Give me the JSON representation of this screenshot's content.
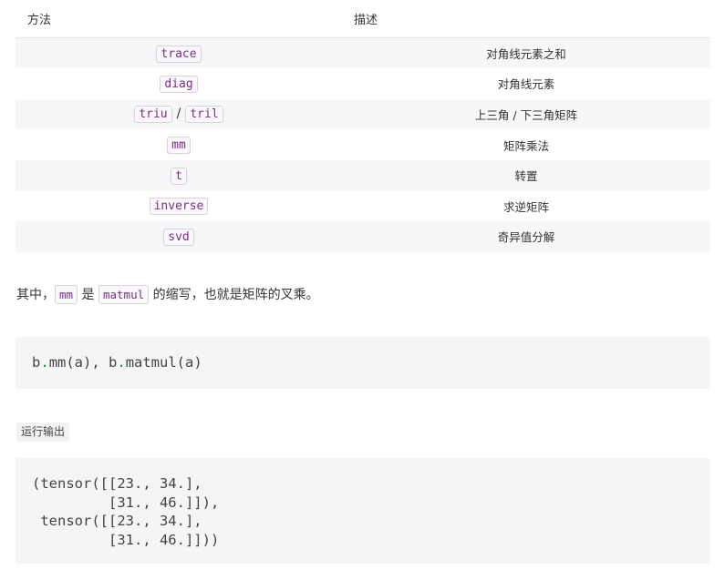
{
  "table": {
    "headers": [
      "方法",
      "描述"
    ],
    "rows": [
      {
        "methods": [
          "trace"
        ],
        "separator": "",
        "desc": "对角线元素之和"
      },
      {
        "methods": [
          "diag"
        ],
        "separator": "",
        "desc": "对角线元素"
      },
      {
        "methods": [
          "triu",
          "tril"
        ],
        "separator": "/",
        "desc": "上三角 / 下三角矩阵"
      },
      {
        "methods": [
          "mm"
        ],
        "separator": "",
        "desc": "矩阵乘法"
      },
      {
        "methods": [
          "t"
        ],
        "separator": "",
        "desc": "转置"
      },
      {
        "methods": [
          "inverse"
        ],
        "separator": "",
        "desc": "求逆矩阵"
      },
      {
        "methods": [
          "svd"
        ],
        "separator": "",
        "desc": "奇异值分解"
      }
    ]
  },
  "paragraph": {
    "text1": "其中，",
    "code1": "mm",
    "text2": " 是 ",
    "code2": "matmul",
    "text3": " 的缩写，也就是矩阵的叉乘。"
  },
  "code_block": {
    "p1": "b",
    "d1": ".",
    "p2": "mm(a), b",
    "d2": ".",
    "p3": "matmul(a)"
  },
  "output_label": "运行输出",
  "output_text": "(tensor([[23., 34.],\n         [31., 46.]]),\n tensor([[23., 34.],\n         [31., 46.]]))"
}
